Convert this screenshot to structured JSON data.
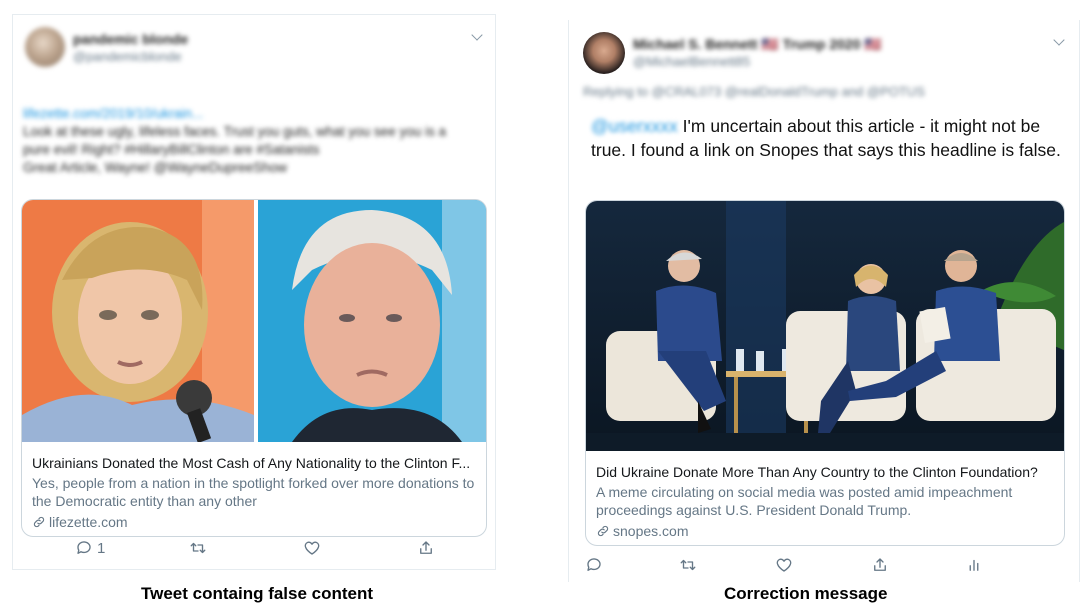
{
  "left_tweet": {
    "user_name": "pandemic blonde",
    "user_handle": "@pandemicblonde",
    "body_lines": [
      {
        "link": "lifezette.com/2019/10/ukrain...",
        "text": ""
      },
      {
        "link": "",
        "text": "Look at these ugly, lifeless faces. Trust you guts, what you see you is a"
      },
      {
        "link": "",
        "text": "pure evil! Right? #HillaryBillClinton are #Satanists"
      },
      {
        "link": "",
        "text": "Great Article, Wayne! @WayneDupreeShow"
      }
    ],
    "card": {
      "title": "Ukrainians Donated the Most Cash of Any Nationality to the Clinton F...",
      "description": "Yes, people from a nation in the spotlight forked over more donations to the Democratic entity than any other",
      "url": "lifezette.com"
    },
    "actions": {
      "reply_count": "1"
    },
    "caption": "Tweet containg false content"
  },
  "right_tweet": {
    "user_name": "Michael S. Bennett 🇺🇸 Trump 2020 🇺🇸",
    "user_handle": "@MichaelBennett85",
    "replying_to": "Replying to @CRAL073 @realDonaldTrump and @POTUS",
    "mention": "@userxxxx",
    "body": " I'm uncertain about this article - it might not be true. I found a link on Snopes that says this headline is false.",
    "card": {
      "title": "Did Ukraine Donate More Than Any Country to the Clinton Foundation?",
      "description": "A meme circulating on social media was posted amid impeachment proceedings against U.S. President Donald Trump.",
      "url": "snopes.com"
    },
    "caption": "Correction message"
  },
  "colors": {
    "link_blue": "#1b95e0",
    "muted_gray": "#657786",
    "border": "#ccd6dd"
  }
}
